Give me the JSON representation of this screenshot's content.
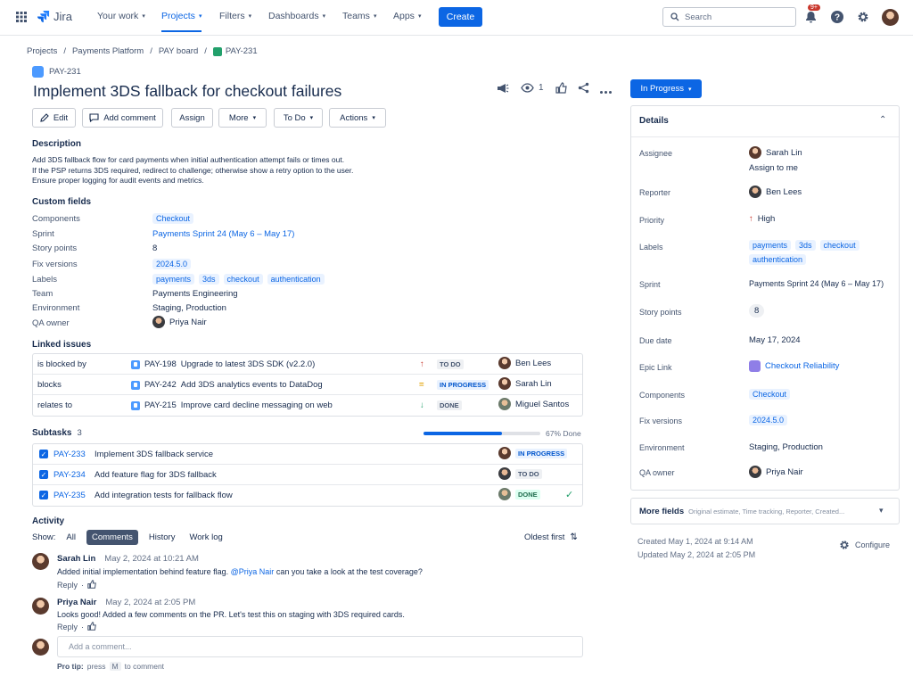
{
  "nav": {
    "logo": "Jira",
    "items": [
      {
        "label": "Your work",
        "active": false
      },
      {
        "label": "Projects",
        "active": true
      },
      {
        "label": "Filters",
        "active": false
      },
      {
        "label": "Dashboards",
        "active": false
      },
      {
        "label": "Teams",
        "active": false
      },
      {
        "label": "Apps",
        "active": false
      }
    ],
    "create_label": "Create",
    "search_placeholder": "Search",
    "notification_badge": "9+"
  },
  "breadcrumb": [
    "Projects",
    "Payments Platform",
    "PAY board",
    "PAY-231"
  ],
  "issue": {
    "key": "PAY-231",
    "title": "Implement 3DS fallback for checkout failures",
    "watchers": "1",
    "status": "In Progress"
  },
  "toolbar": {
    "edit": "Edit",
    "add_comment": "Add comment",
    "assign": "Assign",
    "more": "More",
    "todo": "To Do",
    "actions": "Actions"
  },
  "description": {
    "heading": "Description",
    "lines": [
      "Add 3DS fallback flow for card payments when initial authentication attempt fails or times out.",
      "If the PSP returns 3DS required, redirect to challenge; otherwise show a retry option to the user.",
      "Ensure proper logging for audit events and metrics."
    ]
  },
  "custom_fields": {
    "heading": "Custom fields",
    "components_label": "Components",
    "components": "Checkout",
    "sprint_label": "Sprint",
    "sprint": "Payments Sprint 24 (May 6 – May 17)",
    "story_points_label": "Story points",
    "story_points": "8",
    "fix_versions_label": "Fix versions",
    "fix_versions": "2024.5.0",
    "labels_label": "Labels",
    "labels": [
      "payments",
      "3ds",
      "checkout",
      "authentication"
    ],
    "team_label": "Team",
    "team": "Payments Engineering",
    "environment_label": "Environment",
    "environment": "Staging, Production",
    "qa_owner_label": "QA owner",
    "qa_owner": "Priya Nair"
  },
  "linked_issues": {
    "heading": "Linked issues",
    "rows": [
      {
        "relation": "is blocked by",
        "key": "PAY-198",
        "summary": "Upgrade to latest 3DS SDK (v2.2.0)",
        "priority": "↑",
        "status": "TO DO",
        "assignee": "Ben Lees"
      },
      {
        "relation": "blocks",
        "key": "PAY-242",
        "summary": "Add 3DS analytics events to DataDog",
        "priority": "=",
        "status": "IN PROGRESS",
        "assignee": "Sarah Lin"
      },
      {
        "relation": "relates to",
        "key": "PAY-215",
        "summary": "Improve card decline messaging on web",
        "priority": "↓",
        "status": "DONE",
        "assignee": "Miguel Santos"
      }
    ]
  },
  "subtasks": {
    "heading": "Subtasks",
    "count": "3",
    "progress_pct": 67,
    "progress_label": "67% Done",
    "rows": [
      {
        "key": "PAY-233",
        "summary": "Implement 3DS fallback service",
        "status": "IN PROGRESS"
      },
      {
        "key": "PAY-234",
        "summary": "Add feature flag for 3DS fallback",
        "status": "TO DO"
      },
      {
        "key": "PAY-235",
        "summary": "Add integration tests for fallback flow",
        "status": "DONE"
      }
    ]
  },
  "activity": {
    "heading": "Activity",
    "show_label": "Show:",
    "filters": [
      "All",
      "Comments",
      "History",
      "Work log"
    ],
    "sort": "Oldest first",
    "comments": [
      {
        "author": "Sarah Lin",
        "time": "May 2, 2024 at 10:21 AM",
        "text_before": "Added initial implementation behind feature flag.",
        "mention": "@Priya Nair",
        "text_after": "can you take a look at the test coverage?",
        "reply": "Reply"
      },
      {
        "author": "Priya Nair",
        "time": "May 2, 2024 at 2:05 PM",
        "text": "Looks good! Added a few comments on the PR. Let's test this on staging with 3DS required cards.",
        "reply": "Reply"
      }
    ],
    "add_comment_placeholder": "Add a comment...",
    "pro_tip_label": "Pro tip:",
    "pro_tip_press": "press",
    "pro_tip_key": "M",
    "pro_tip_rest": "to comment"
  },
  "details": {
    "heading": "Details",
    "assignee_label": "Assignee",
    "assignee": "Sarah Lin",
    "assign_to_me": "Assign to me",
    "reporter_label": "Reporter",
    "reporter": "Ben Lees",
    "priority_label": "Priority",
    "priority": "High",
    "labels_label": "Labels",
    "labels": [
      "payments",
      "3ds",
      "checkout",
      "authentication"
    ],
    "sprint_label": "Sprint",
    "sprint": "Payments Sprint 24 (May 6 – May 17)",
    "story_points_label": "Story points",
    "story_points": "8",
    "due_date_label": "Due date",
    "due_date": "May 17, 2024",
    "epic_link_label": "Epic Link",
    "epic_link": "Checkout Reliability",
    "components_label": "Components",
    "components": "Checkout",
    "fix_versions_label": "Fix versions",
    "fix_versions": "2024.5.0",
    "environment_label": "Environment",
    "environment": "Staging, Production",
    "qa_owner_label": "QA owner",
    "qa_owner": "Priya Nair"
  },
  "more_fields": {
    "label": "More fields",
    "hint": "Original estimate, Time tracking, Reporter, Created..."
  },
  "meta": {
    "created": "Created May 1, 2024 at 9:14 AM",
    "updated": "Updated May 2, 2024 at 2:05 PM",
    "configure": "Configure"
  },
  "colors": {
    "accent": "#0c66e4",
    "high_priority": "#c9372c",
    "medium_priority": "#e2a203",
    "low_priority": "#22a06b"
  }
}
